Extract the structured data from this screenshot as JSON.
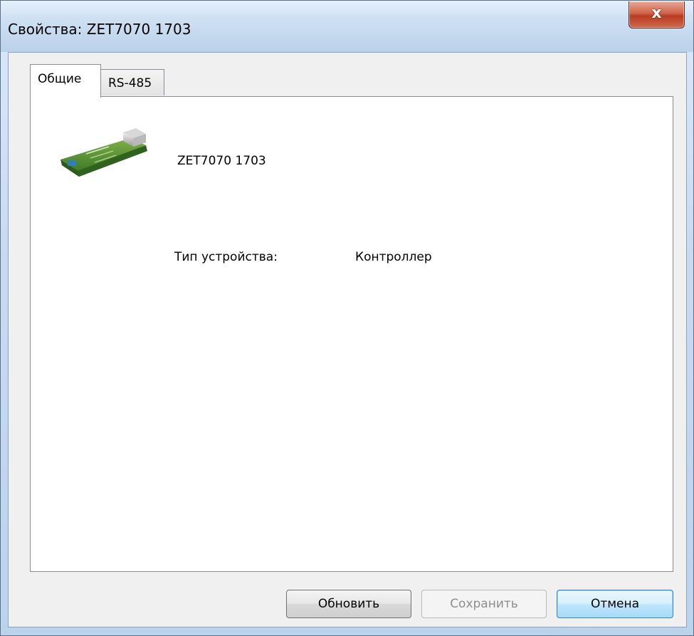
{
  "window": {
    "title": "Свойства: ZET7070 1703",
    "close_label": "x"
  },
  "tabs": [
    {
      "label": "Общие",
      "selected": true
    },
    {
      "label": "RS-485",
      "selected": false
    }
  ],
  "general": {
    "device_icon": "usb-controller-board-icon",
    "device_name": "ZET7070 1703",
    "type_label": "Тип устройства:",
    "type_value": "Контроллер"
  },
  "buttons": {
    "refresh_label": "Обновить",
    "save_label": "Сохранить",
    "save_enabled": false,
    "cancel_label": "Отмена"
  },
  "colors": {
    "titlebar": "#cfe0f3",
    "close_button": "#c8563b",
    "dialog_background": "#f0f0f0",
    "default_button_border": "#3c7fb1"
  }
}
